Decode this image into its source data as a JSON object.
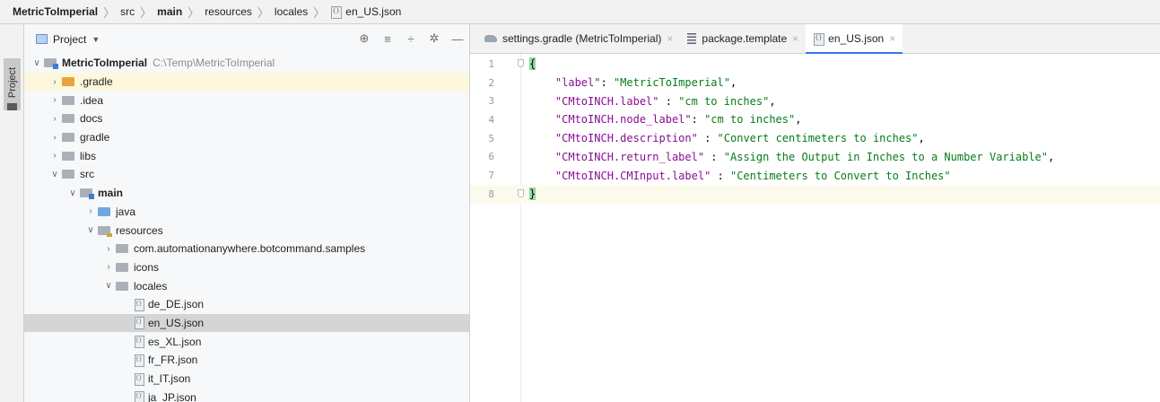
{
  "breadcrumb": {
    "items": [
      "MetricToImperial",
      "src",
      "main",
      "resources",
      "locales",
      "en_US.json"
    ],
    "bold": [
      true,
      false,
      true,
      false,
      false,
      false
    ]
  },
  "tool_stripe": {
    "project_label": "Project"
  },
  "project_panel": {
    "title": "Project",
    "header_icons": [
      "target-icon",
      "collapse-icon",
      "expand-icon",
      "settings-icon",
      "hide-icon"
    ],
    "tree": [
      {
        "depth": 0,
        "arrow": "down",
        "icon": "module",
        "name": "MetricToImperial",
        "bold": true,
        "path": "C:\\Temp\\MetricToImperial"
      },
      {
        "depth": 1,
        "arrow": "right",
        "icon": "orange",
        "name": ".gradle",
        "highlight": "yellow"
      },
      {
        "depth": 1,
        "arrow": "right",
        "icon": "folder",
        "name": ".idea"
      },
      {
        "depth": 1,
        "arrow": "right",
        "icon": "folder",
        "name": "docs"
      },
      {
        "depth": 1,
        "arrow": "right",
        "icon": "folder",
        "name": "gradle"
      },
      {
        "depth": 1,
        "arrow": "right",
        "icon": "folder",
        "name": "libs"
      },
      {
        "depth": 1,
        "arrow": "down",
        "icon": "folder",
        "name": "src"
      },
      {
        "depth": 2,
        "arrow": "down",
        "icon": "module",
        "name": "main",
        "bold": true
      },
      {
        "depth": 3,
        "arrow": "right",
        "icon": "blue",
        "name": "java"
      },
      {
        "depth": 3,
        "arrow": "down",
        "icon": "res",
        "name": "resources"
      },
      {
        "depth": 4,
        "arrow": "right",
        "icon": "folder",
        "name": "com.automationanywhere.botcommand.samples"
      },
      {
        "depth": 4,
        "arrow": "right",
        "icon": "folder",
        "name": "icons"
      },
      {
        "depth": 4,
        "arrow": "down",
        "icon": "folder",
        "name": "locales"
      },
      {
        "depth": 5,
        "arrow": "none",
        "icon": "json",
        "name": "de_DE.json"
      },
      {
        "depth": 5,
        "arrow": "none",
        "icon": "json",
        "name": "en_US.json",
        "highlight": "selected"
      },
      {
        "depth": 5,
        "arrow": "none",
        "icon": "json",
        "name": "es_XL.json"
      },
      {
        "depth": 5,
        "arrow": "none",
        "icon": "json",
        "name": "fr_FR.json"
      },
      {
        "depth": 5,
        "arrow": "none",
        "icon": "json",
        "name": "it_IT.json"
      },
      {
        "depth": 5,
        "arrow": "none",
        "icon": "json",
        "name": "ja_JP.json"
      }
    ]
  },
  "editor": {
    "tabs": [
      {
        "label": "settings.gradle (MetricToImperial)",
        "icon": "gradle",
        "active": false
      },
      {
        "label": "package.template",
        "icon": "text",
        "active": false
      },
      {
        "label": "en_US.json",
        "icon": "json",
        "active": true
      }
    ],
    "lines": [
      {
        "n": "1",
        "parts": [
          {
            "t": "{",
            "c": "brace-hl"
          }
        ]
      },
      {
        "n": "2",
        "parts": [
          {
            "t": "    "
          },
          {
            "t": "\"label\"",
            "c": "k"
          },
          {
            "t": ": "
          },
          {
            "t": "\"MetricToImperial\"",
            "c": "s"
          },
          {
            "t": ","
          }
        ]
      },
      {
        "n": "3",
        "parts": [
          {
            "t": "    "
          },
          {
            "t": "\"CMtoINCH.label\"",
            "c": "k"
          },
          {
            "t": " : "
          },
          {
            "t": "\"cm to inches\"",
            "c": "s"
          },
          {
            "t": ","
          }
        ]
      },
      {
        "n": "4",
        "parts": [
          {
            "t": "    "
          },
          {
            "t": "\"CMtoINCH.node_label\"",
            "c": "k"
          },
          {
            "t": ": "
          },
          {
            "t": "\"cm to inches\"",
            "c": "s"
          },
          {
            "t": ","
          }
        ]
      },
      {
        "n": "5",
        "parts": [
          {
            "t": "    "
          },
          {
            "t": "\"CMtoINCH.description\"",
            "c": "k"
          },
          {
            "t": " : "
          },
          {
            "t": "\"Convert centimeters to inches\"",
            "c": "s"
          },
          {
            "t": ","
          }
        ]
      },
      {
        "n": "6",
        "parts": [
          {
            "t": "    "
          },
          {
            "t": "\"CMtoINCH.return_label\"",
            "c": "k"
          },
          {
            "t": " : "
          },
          {
            "t": "\"Assign the Output in Inches to a Number Variable\"",
            "c": "s"
          },
          {
            "t": ","
          }
        ]
      },
      {
        "n": "7",
        "parts": [
          {
            "t": "    "
          },
          {
            "t": "\"CMtoINCH.CMInput.label\"",
            "c": "k"
          },
          {
            "t": " : "
          },
          {
            "t": "\"Centimeters to Convert to Inches\"",
            "c": "s"
          }
        ]
      },
      {
        "n": "8",
        "parts": [
          {
            "t": "}",
            "c": "brace-hl"
          }
        ],
        "current": true
      }
    ]
  }
}
